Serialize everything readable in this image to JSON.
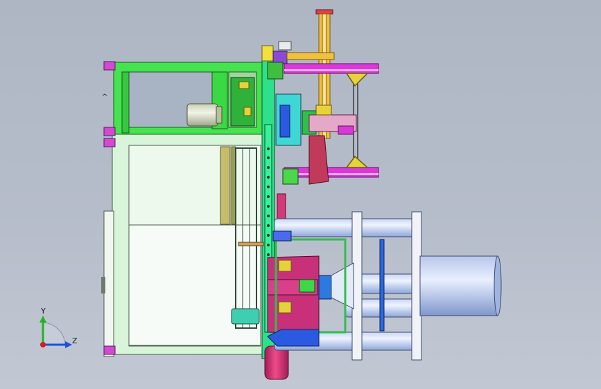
{
  "view": {
    "type": "cad-3d-viewport",
    "background_top": "#aeb6c4",
    "background_bottom": "#c2c8d3"
  },
  "triad": {
    "y_label": "Y",
    "z_label": "Z",
    "y_color": "#1fb51f",
    "z_color": "#1f4fe0",
    "x_color": "#d01f1f"
  },
  "colors": {
    "frame_green": "#3fe64a",
    "frame_pale": "#d6f3d6",
    "magenta": "#d23ad2",
    "cyan": "#3fd6d6",
    "steel_blue": "#9fb8e6",
    "crimson": "#c6286a",
    "olive": "#b8b060",
    "yellow": "#e6d23a"
  }
}
